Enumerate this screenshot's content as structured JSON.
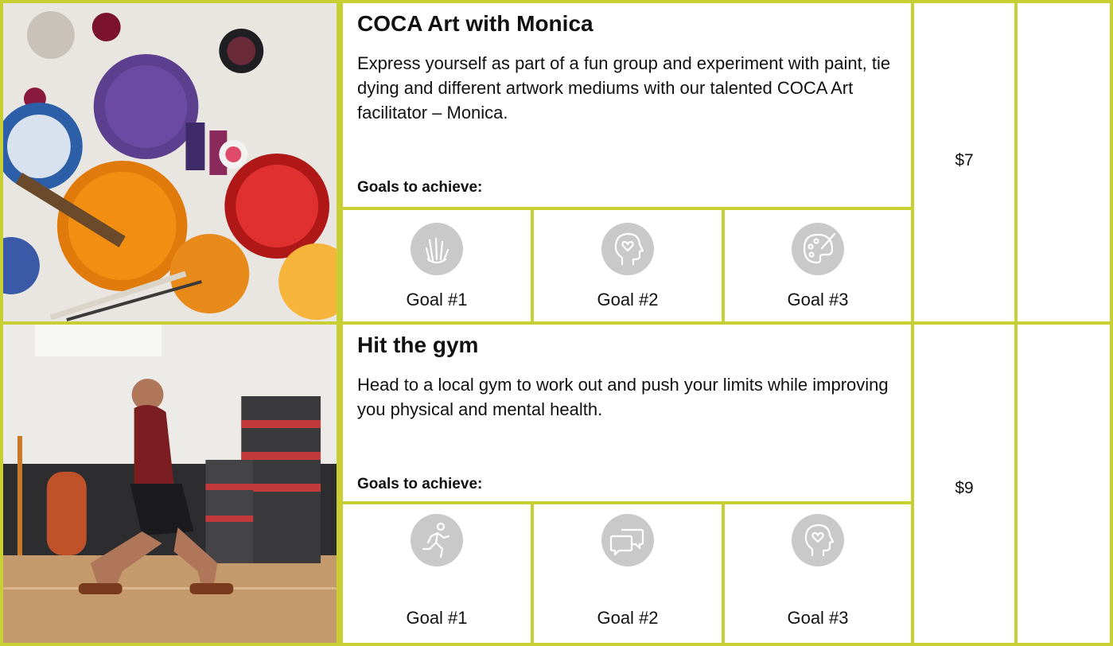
{
  "activities": [
    {
      "title": "COCA Art with Monica",
      "description": "Express yourself as part of a fun group and experiment with paint, tie dying and different artwork mediums with our talented COCA Art facilitator – Monica.",
      "goals_heading": "Goals to achieve:",
      "price": "$7",
      "image": "paint-cans-photo",
      "goals": [
        {
          "label": "Goal #1",
          "icon": "hand-gesture-icon"
        },
        {
          "label": "Goal #2",
          "icon": "head-heart-icon"
        },
        {
          "label": "Goal #3",
          "icon": "paint-palette-icon"
        }
      ]
    },
    {
      "title": "Hit the gym",
      "description": "Head to a local gym to work out and push your limits while improving you physical and mental health.",
      "goals_heading": "Goals to achieve:",
      "price": "$9",
      "image": "gym-lunge-photo",
      "goals": [
        {
          "label": "Goal #1",
          "icon": "running-person-icon"
        },
        {
          "label": "Goal #2",
          "icon": "chat-bubbles-icon"
        },
        {
          "label": "Goal #3",
          "icon": "head-heart-icon"
        }
      ]
    }
  ],
  "colors": {
    "border": "#c8cf32",
    "icon_bg": "#c9c9c9",
    "icon_fg": "#ffffff"
  }
}
